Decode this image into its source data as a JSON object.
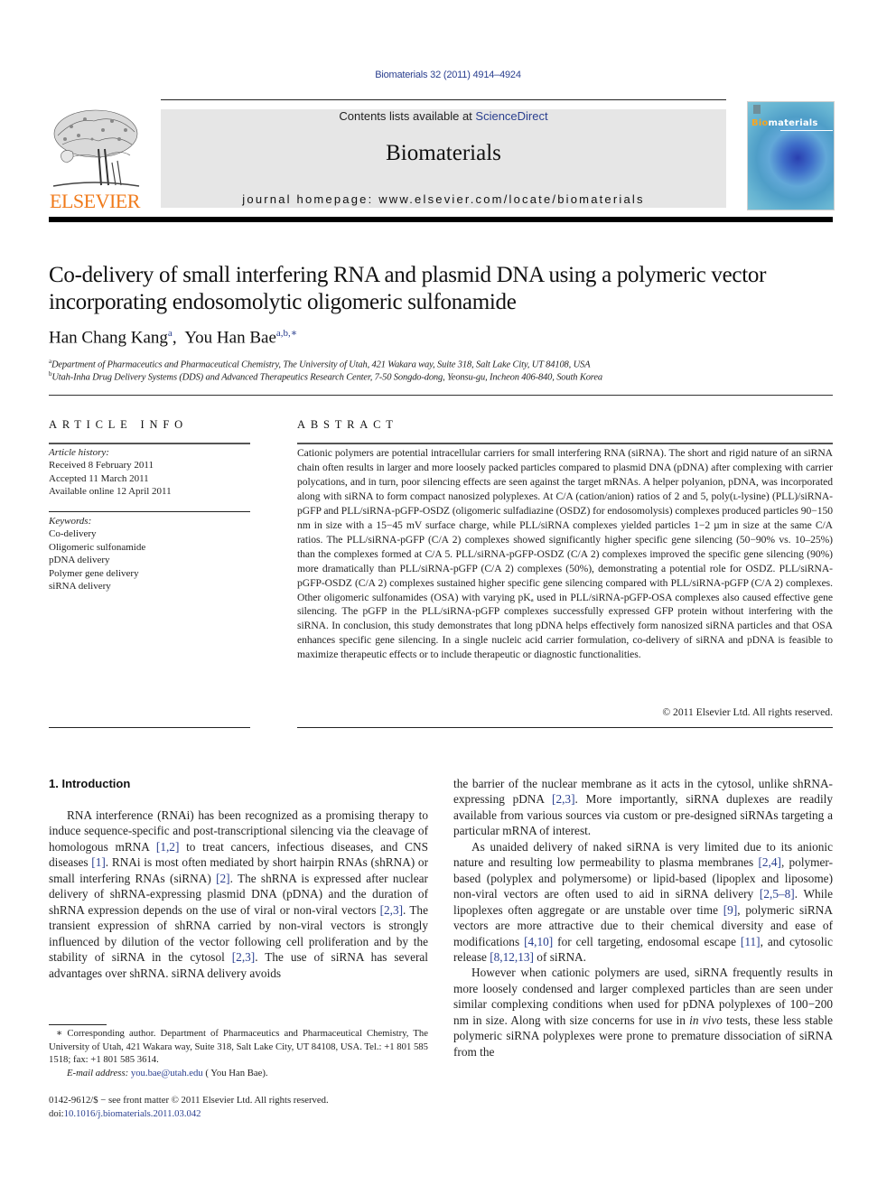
{
  "citation_line": "Biomaterials 32 (2011) 4914–4924",
  "header": {
    "publisher": "ELSEVIER",
    "contents_prefix": "Contents lists available at ",
    "contents_link": "ScienceDirect",
    "journal_name": "Biomaterials",
    "homepage_line": "journal homepage: www.elsevier.com/locate/biomaterials",
    "cover_title_accent": "Bio",
    "cover_title_rest": "materials",
    "accent_color": "#f07a1a",
    "link_color": "#2a3f8f"
  },
  "article": {
    "title_line1": "Co-delivery of small interfering RNA and plasmid DNA using a polymeric vector",
    "title_line2": "incorporating endosomolytic oligomeric sulfonamide",
    "authors": [
      {
        "name": "Han Chang Kang",
        "sup": "a"
      },
      {
        "name": "You Han Bae",
        "sup": "a,b,∗"
      }
    ],
    "affiliations": [
      {
        "sup": "a",
        "text": "Department of Pharmaceutics and Pharmaceutical Chemistry, The University of Utah, 421 Wakara way, Suite 318, Salt Lake City, UT 84108, USA"
      },
      {
        "sup": "b",
        "text": "Utah-Inha Drug Delivery Systems (DDS) and Advanced Therapeutics Research Center, 7-50 Songdo-dong, Yeonsu-gu, Incheon 406-840, South Korea"
      }
    ]
  },
  "article_info": {
    "heading": "ARTICLE INFO",
    "history_label": "Article history:",
    "history": [
      "Received 8 February 2011",
      "Accepted 11 March 2011",
      "Available online 12 April 2011"
    ],
    "keywords_label": "Keywords:",
    "keywords": [
      "Co-delivery",
      "Oligomeric sulfonamide",
      "pDNA delivery",
      "Polymer gene delivery",
      "siRNA delivery"
    ]
  },
  "abstract": {
    "heading": "ABSTRACT",
    "text": "Cationic polymers are potential intracellular carriers for small interfering RNA (siRNA). The short and rigid nature of an siRNA chain often results in larger and more loosely packed particles compared to plasmid DNA (pDNA) after complexing with carrier polycations, and in turn, poor silencing effects are seen against the target mRNAs. A helper polyanion, pDNA, was incorporated along with siRNA to form compact nanosized polyplexes. At C/A (cation/anion) ratios of 2 and 5, poly(ʟ-lysine) (PLL)/siRNA-pGFP and PLL/siRNA-pGFP-OSDZ (oligomeric sulfadiazine (OSDZ) for endosomolysis) complexes produced particles 90−150 nm in size with a 15−45 mV surface charge, while PLL/siRNA complexes yielded particles 1−2 µm in size at the same C/A ratios. The PLL/siRNA-pGFP (C/A 2) complexes showed significantly higher specific gene silencing (50−90% vs. 10–25%) than the complexes formed at C/A 5. PLL/siRNA-pGFP-OSDZ (C/A 2) complexes improved the specific gene silencing (90%) more dramatically than PLL/siRNA-pGFP (C/A 2) complexes (50%), demonstrating a potential role for OSDZ. PLL/siRNA-pGFP-OSDZ (C/A 2) complexes sustained higher specific gene silencing compared with PLL/siRNA-pGFP (C/A 2) complexes. Other oligomeric sulfonamides (OSA) with varying pKₐ used in PLL/siRNA-pGFP-OSA complexes also caused effective gene silencing. The pGFP in the PLL/siRNA-pGFP complexes successfully expressed GFP protein without interfering with the siRNA. In conclusion, this study demonstrates that long pDNA helps effectively form nanosized siRNA particles and that OSA enhances specific gene silencing. In a single nucleic acid carrier formulation, co-delivery of siRNA and pDNA is feasible to maximize therapeutic effects or to include therapeutic or diagnostic functionalities.",
    "copyright": "© 2011 Elsevier Ltd. All rights reserved."
  },
  "introduction": {
    "heading": "1.  Introduction",
    "left_col": {
      "p1": [
        {
          "t": "RNA interference (RNAi) has been recognized as a promising therapy to induce sequence-specific and post-transcriptional silencing via the cleavage of homologous mRNA "
        },
        {
          "ref": "[1,2]"
        },
        {
          "t": " to treat cancers, infectious diseases, and CNS diseases "
        },
        {
          "ref": "[1]"
        },
        {
          "t": ". RNAi is most often mediated by short hairpin RNAs (shRNA) or small interfering RNAs (siRNA) "
        },
        {
          "ref": "[2]"
        },
        {
          "t": ". The shRNA is expressed after nuclear delivery of shRNA-expressing plasmid DNA (pDNA) and the duration of shRNA expression depends on the use of viral or non-viral vectors "
        },
        {
          "ref": "[2,3]"
        },
        {
          "t": ". The transient expression of shRNA carried by non-viral vectors is strongly influenced by dilution of the vector following cell proliferation and by the stability of siRNA in the cytosol "
        },
        {
          "ref": "[2,3]"
        },
        {
          "t": ". The use of siRNA has several advantages over shRNA. siRNA delivery avoids"
        }
      ]
    },
    "right_col": {
      "p1": [
        {
          "t": "the barrier of the nuclear membrane as it acts in the cytosol, unlike shRNA-expressing pDNA "
        },
        {
          "ref": "[2,3]"
        },
        {
          "t": ". More importantly, siRNA duplexes are readily available from various sources via custom or pre-designed siRNAs targeting a particular mRNA of interest."
        }
      ],
      "p2": [
        {
          "t": "As unaided delivery of naked siRNA is very limited due to its anionic nature and resulting low permeability to plasma membranes "
        },
        {
          "ref": "[2,4]"
        },
        {
          "t": ", polymer-based (polyplex and polymersome) or lipid-based (lipoplex and liposome) non-viral vectors are often used to aid in siRNA delivery "
        },
        {
          "ref": "[2,5–8]"
        },
        {
          "t": ". While lipoplexes often aggregate or are unstable over time "
        },
        {
          "ref": "[9]"
        },
        {
          "t": ", polymeric siRNA vectors are more attractive due to their chemical diversity and ease of modifications "
        },
        {
          "ref": "[4,10]"
        },
        {
          "t": " for cell targeting, endosomal escape "
        },
        {
          "ref": "[11]"
        },
        {
          "t": ", and cytosolic release "
        },
        {
          "ref": "[8,12,13]"
        },
        {
          "t": " of siRNA."
        }
      ],
      "p3": [
        {
          "t": "However when cationic polymers are used, siRNA frequently results in more loosely condensed and larger complexed particles than are seen under similar complexing conditions when used for pDNA polyplexes of 100−200 nm in size. Along with size concerns for use in "
        },
        {
          "i": "in vivo"
        },
        {
          "t": " tests, these less stable polymeric siRNA polyplexes were prone to premature dissociation of siRNA from the"
        }
      ]
    }
  },
  "footnote": {
    "corresponding": "∗ Corresponding author. Department of Pharmaceutics and Pharmaceutical Chemistry, The University of Utah, 421 Wakara way, Suite 318, Salt Lake City, UT 84108, USA. Tel.: +1 801 585 1518; fax: +1 801 585 3614.",
    "email_label": "E-mail address:",
    "email": "you.bae@utah.edu",
    "email_suffix": " ( You Han Bae).",
    "front_matter": "0142-9612/$ − see front matter © 2011 Elsevier Ltd. All rights reserved.",
    "doi_prefix": "doi:",
    "doi": "10.1016/j.biomaterials.2011.03.042"
  }
}
